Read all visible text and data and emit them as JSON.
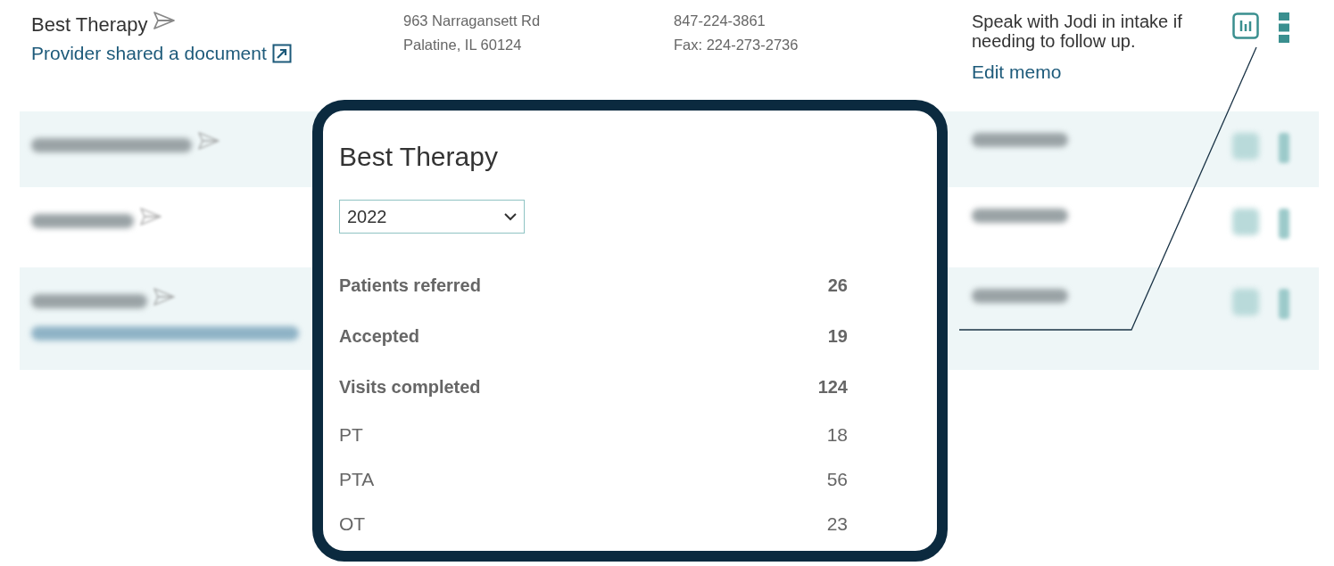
{
  "providers": [
    {
      "name": "Best Therapy",
      "document_link": "Provider shared a document",
      "address": [
        "963 Narragansett Rd",
        "Palatine, IL 60124"
      ],
      "phone": "847-224-3861",
      "fax": "Fax: 224-273-2736",
      "memo": "Speak with Jodi in intake if needing to follow up.",
      "memo_action": "Edit memo"
    }
  ],
  "blurred_rows": [
    {
      "document_link": false
    },
    {
      "document_link": false
    },
    {
      "document_link": true
    }
  ],
  "popup": {
    "title": "Best Therapy",
    "year": "2022",
    "stats": [
      {
        "label": "Patients referred",
        "value": "26",
        "kind": "total"
      },
      {
        "label": "Accepted",
        "value": "19",
        "kind": "total"
      },
      {
        "label": "Visits completed",
        "value": "124",
        "kind": "total"
      },
      {
        "label": "PT",
        "value": "18",
        "kind": "detail"
      },
      {
        "label": "PTA",
        "value": "56",
        "kind": "detail"
      },
      {
        "label": "OT",
        "value": "23",
        "kind": "detail"
      }
    ]
  }
}
